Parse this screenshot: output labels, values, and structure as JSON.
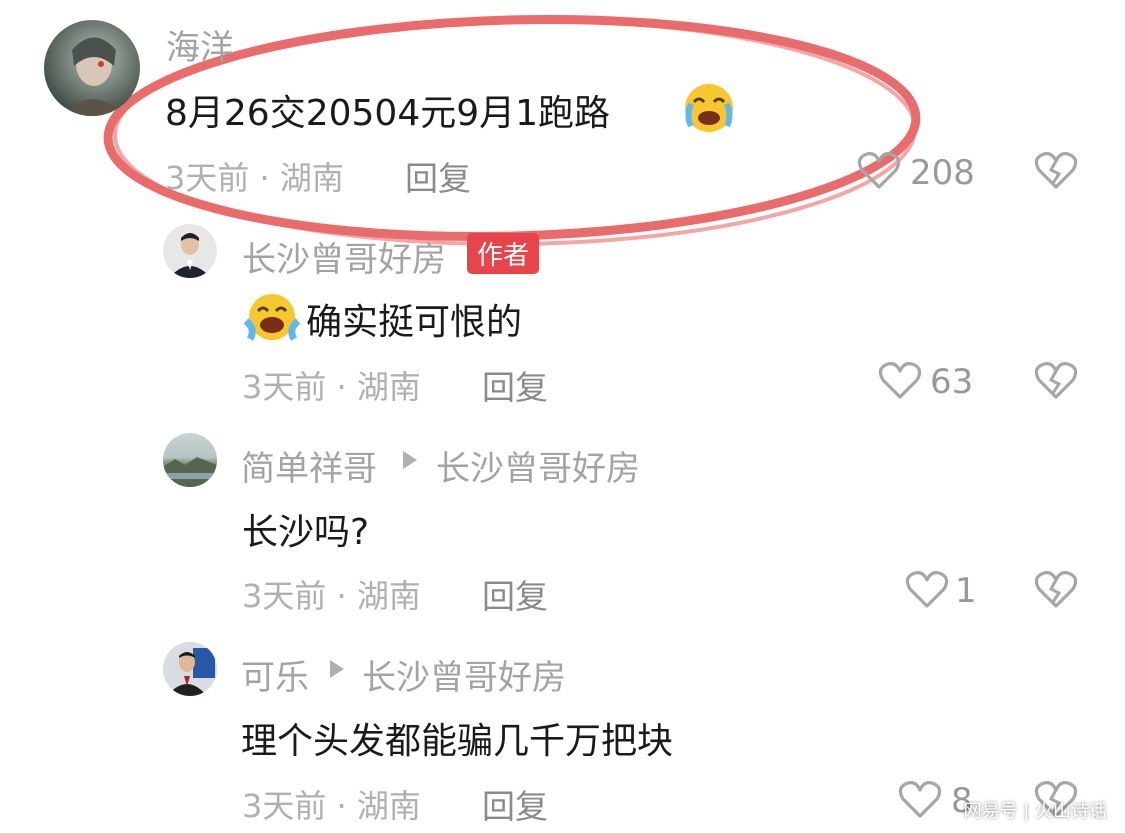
{
  "comments": [
    {
      "author": "海洋",
      "text": "8月26交20504元9月1跑路",
      "meta": "3天前 · 湖南",
      "reply_label": "回复",
      "likes": "208"
    },
    {
      "author": "长沙曾哥好房",
      "badge": "作者",
      "text": "确实挺可恨的",
      "meta": "3天前 · 湖南",
      "reply_label": "回复",
      "likes": "63"
    },
    {
      "author": "简单祥哥",
      "reply_to": "长沙曾哥好房",
      "text": "长沙吗?",
      "meta": "3天前 · 湖南",
      "reply_label": "回复",
      "likes": "1"
    },
    {
      "author": "可乐",
      "reply_to": "长沙曾哥好房",
      "text": "理个头发都能骗几千万把块",
      "meta": "3天前 · 湖南",
      "reply_label": "回复",
      "likes": "8"
    }
  ],
  "watermark": "网易号 | 火山诗话",
  "icons": [
    "heart-icon",
    "broken-heart-icon",
    "crying-emoji-icon",
    "reply-arrow-icon"
  ],
  "colors": {
    "badge": "#e8444c",
    "highlight_circle": "#e23b3b",
    "meta": "#b0b0b0"
  }
}
